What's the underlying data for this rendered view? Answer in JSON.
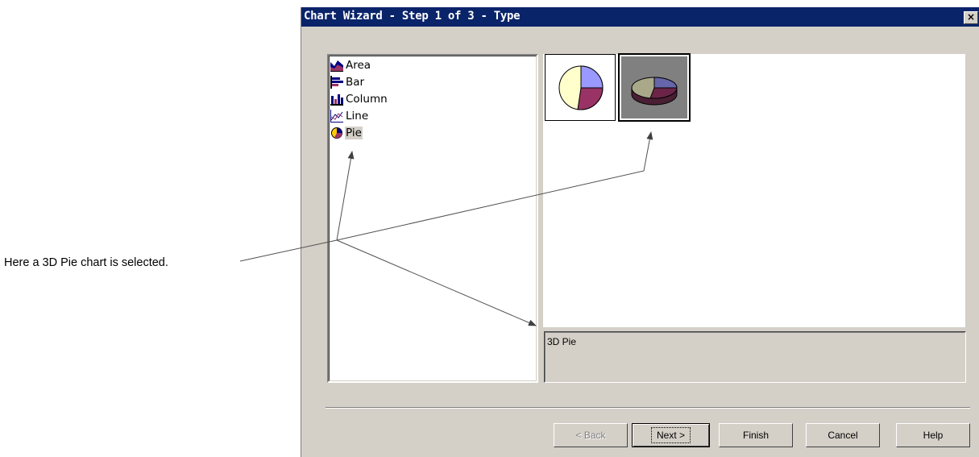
{
  "callout": {
    "text": "Here a 3D Pie chart is selected."
  },
  "dialog": {
    "title": "Chart Wizard - Step 1 of 3 - Type",
    "close_label": "×",
    "chart_types": [
      {
        "label": "Area",
        "icon": "area-chart-icon"
      },
      {
        "label": "Bar",
        "icon": "bar-chart-icon"
      },
      {
        "label": "Column",
        "icon": "column-chart-icon"
      },
      {
        "label": "Line",
        "icon": "line-chart-icon"
      },
      {
        "label": "Pie",
        "icon": "pie-chart-icon",
        "selected": true
      }
    ],
    "subtypes": [
      {
        "icon": "pie-2d-icon",
        "selected": false
      },
      {
        "icon": "pie-3d-icon",
        "selected": true
      }
    ],
    "description": "3D Pie",
    "buttons": {
      "back": "< Back",
      "next": "Next >",
      "finish": "Finish",
      "cancel": "Cancel",
      "help": "Help"
    }
  },
  "colors": {
    "titlebar": "#0a246a",
    "dialog_bg": "#d4d0c8",
    "pie_blue": "#9999ff",
    "pie_maroon": "#993366",
    "pie_cream": "#ffffcc"
  }
}
